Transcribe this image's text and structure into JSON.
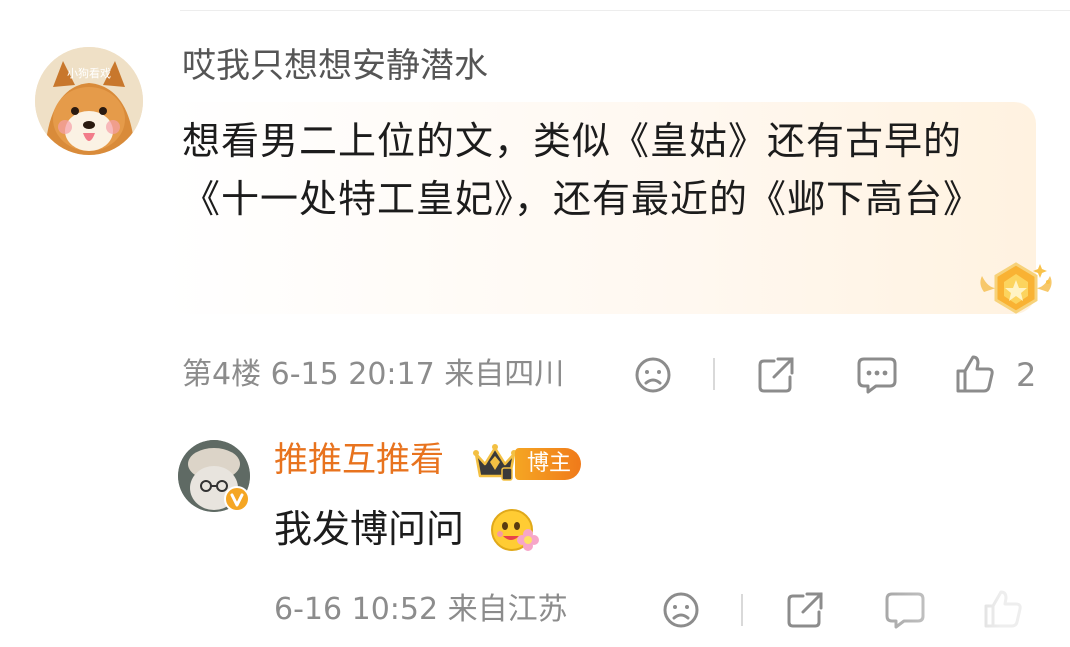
{
  "comments": [
    {
      "username": "哎我只想想安静潜水",
      "avatar_caption": "小狗看戏",
      "text": "想看男二上位的文，类似《皇姑》还有古早的《十一处特工皇妃》，还有最近的《邺下高台》",
      "floor": "第4楼",
      "time": "6-15 20:17",
      "location": "来自四川",
      "likes": "2"
    }
  ],
  "reply": {
    "username": "推推互推看",
    "badge": "博主",
    "text": "我发博问问",
    "time": "6-16 10:52",
    "location": "来自江苏"
  },
  "icons": {
    "dislike": "frown-face-icon",
    "share": "share-icon",
    "comment": "comment-icon",
    "like": "thumbs-up-icon"
  },
  "colors": {
    "blogger_name": "#e8731e",
    "meta": "#8c8c8c"
  }
}
